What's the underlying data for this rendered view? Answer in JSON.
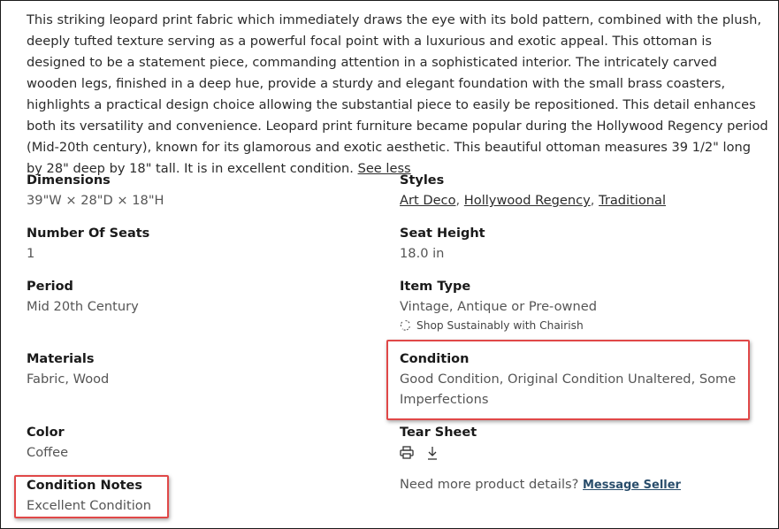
{
  "description": {
    "text": "This striking leopard print fabric which immediately draws the eye with its bold pattern, combined with the plush, deeply tufted texture serving as a powerful focal point with a luxurious and exotic appeal. This ottoman is designed to be a statement piece, commanding attention in a sophisticated interior. The intricately carved wooden legs, finished in a deep hue, provide a sturdy and elegant foundation with the small brass coasters, highlights a practical design choice allowing the substantial piece to easily be repositioned. This detail enhances both its versatility and convenience. Leopard print furniture became popular during the Hollywood Regency period (Mid-20th century), known for its glamorous and exotic aesthetic. This beautiful ottoman measures 39 1/2\" long by 28\" deep by 18\" tall. It is in excellent condition.",
    "see_less": "See less"
  },
  "specs": {
    "dimensions": {
      "label": "Dimensions",
      "value": "39\"W × 28\"D × 18\"H"
    },
    "styles": {
      "label": "Styles",
      "links": [
        "Art Deco",
        "Hollywood Regency",
        "Traditional"
      ]
    },
    "seats": {
      "label": "Number Of Seats",
      "value": "1"
    },
    "seat_height": {
      "label": "Seat Height",
      "value": "18.0 in"
    },
    "period": {
      "label": "Period",
      "value": "Mid 20th Century"
    },
    "item_type": {
      "label": "Item Type",
      "value": "Vintage, Antique or Pre-owned",
      "sustainable": "Shop Sustainably with Chairish"
    },
    "materials": {
      "label": "Materials",
      "value": "Fabric, Wood"
    },
    "condition": {
      "label": "Condition",
      "value_line1": "Good Condition, Original Condition Unaltered, Some",
      "value_line2": "Imperfections"
    },
    "color": {
      "label": "Color",
      "value": "Coffee"
    },
    "tear_sheet": {
      "label": "Tear Sheet",
      "icons": [
        "printer-icon",
        "download-icon"
      ]
    },
    "condition_notes": {
      "label": "Condition Notes",
      "value": "Excellent Condition"
    }
  },
  "more_details": {
    "text": "Need more product details?",
    "link": "Message Seller"
  },
  "colors": {
    "highlight": "#e04848",
    "link": "#2a4e6c",
    "text": "#2b2b2b",
    "muted": "#555555"
  }
}
